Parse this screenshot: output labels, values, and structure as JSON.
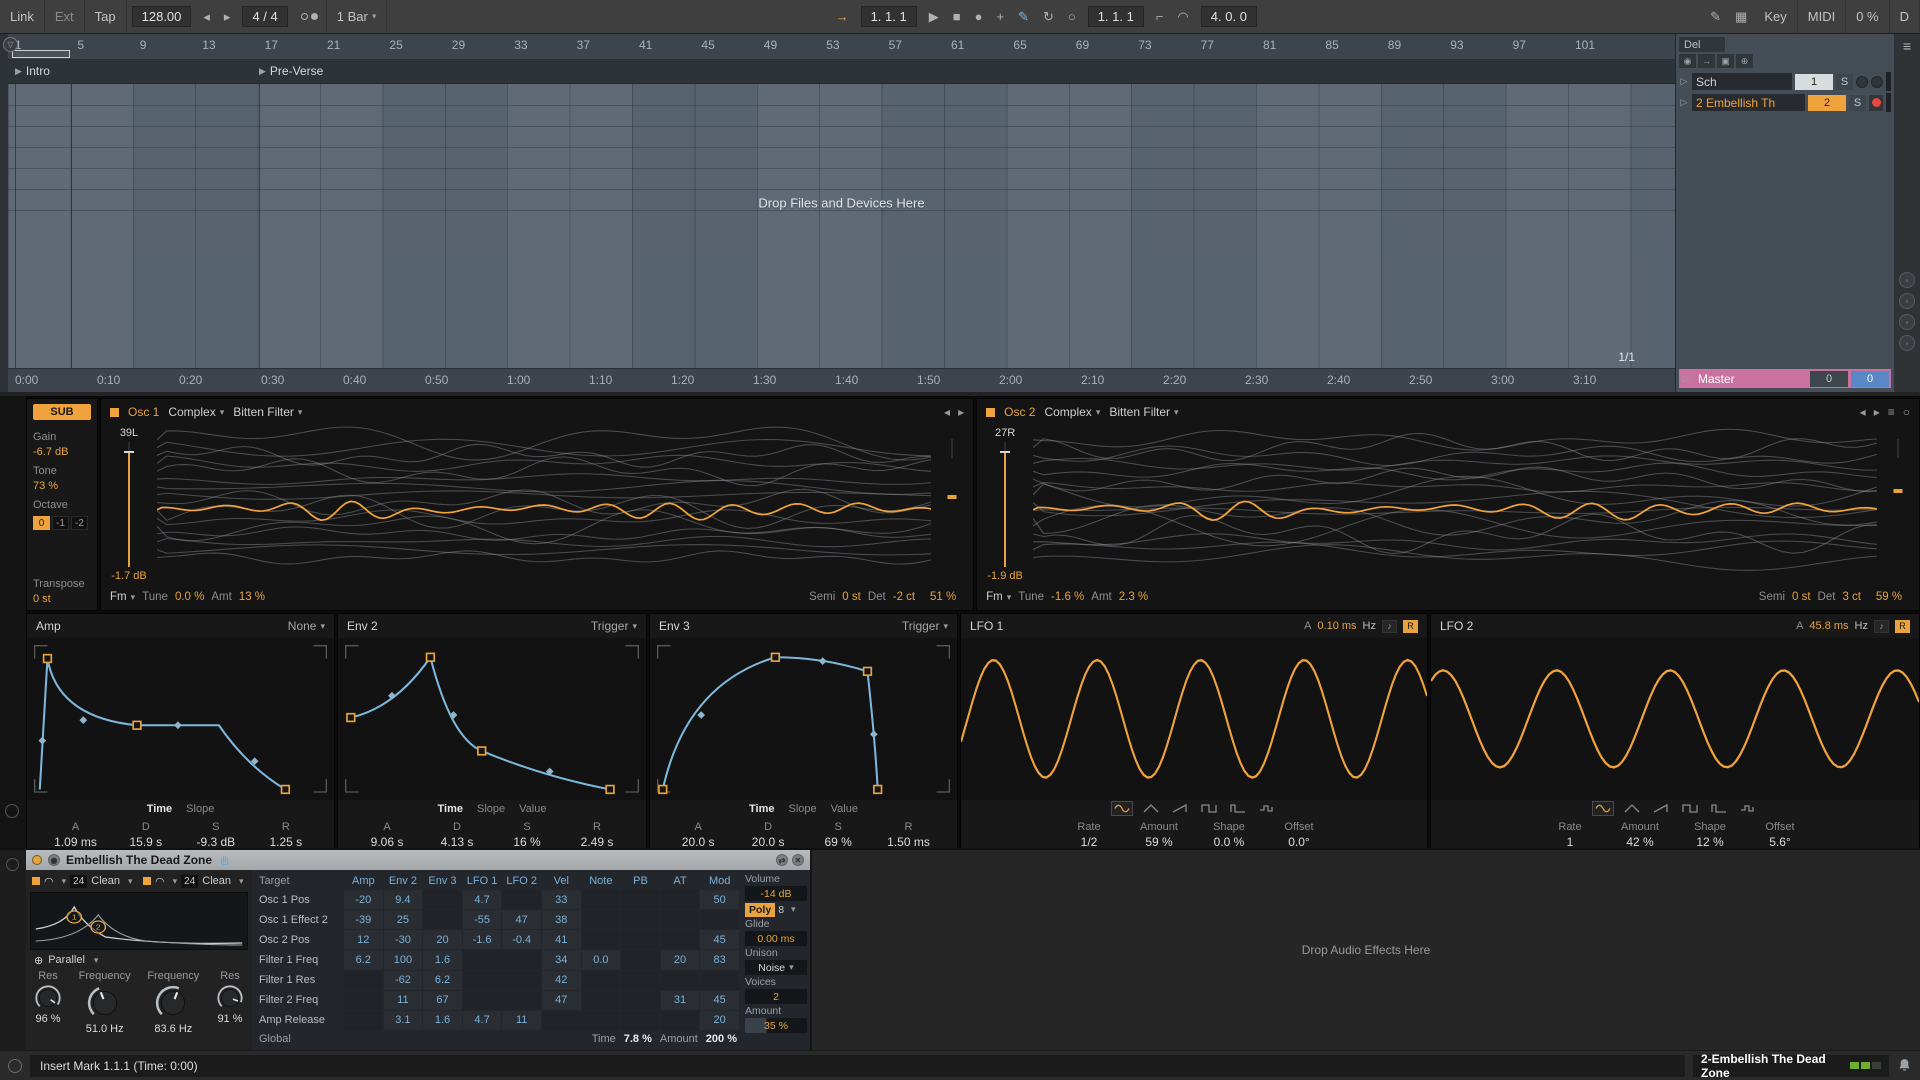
{
  "icons": {
    "caret": "▾",
    "menu": "≡",
    "follow": "→",
    "play": "▶",
    "stop": "■",
    "record": "●",
    "plus": "+",
    "draw": "✎",
    "reenable": "↻",
    "session_record": "○",
    "punch_in": "⌐",
    "slur": "◠",
    "pencil": "✎",
    "keyboard": "▦",
    "prev": "◂",
    "next": "▸",
    "fold": "▷",
    "note": "♪",
    "global_circle": "○",
    "routing": "⊕",
    "track_icons": [
      "◉",
      "→",
      "▣",
      "⊕"
    ]
  },
  "transport": {
    "link": "Link",
    "ext": "Ext",
    "tap": "Tap",
    "tempo": "128.00",
    "time_sig": "4 / 4",
    "quantize": "1 Bar",
    "pos": "1. 1. 1",
    "loop_start": "1. 1. 1",
    "loop_length": "4. 0. 0",
    "key": "Key",
    "midi": "MIDI",
    "cpu": "0 %",
    "disk": "D"
  },
  "arrangement": {
    "bars": [
      "1",
      "5",
      "9",
      "13",
      "17",
      "21",
      "25",
      "29",
      "33",
      "37",
      "41",
      "45",
      "49",
      "53",
      "57",
      "61",
      "65",
      "69",
      "73",
      "77",
      "81",
      "85",
      "89",
      "93",
      "97",
      "101"
    ],
    "times": [
      "0:00",
      "0:10",
      "0:20",
      "0:30",
      "0:40",
      "0:50",
      "1:00",
      "1:10",
      "1:20",
      "1:30",
      "1:40",
      "1:50",
      "2:00",
      "2:10",
      "2:20",
      "2:30",
      "2:40",
      "2:50",
      "3:00",
      "3:10"
    ],
    "locators": [
      {
        "name": "Intro"
      },
      {
        "name": "Pre-Verse"
      }
    ],
    "drop_hint": "Drop Files and Devices Here",
    "loop_ratio": "1/1",
    "del": "Del",
    "tracks": [
      {
        "name": "Sch",
        "num": "1",
        "solo": "S"
      },
      {
        "name": "2 Embellish Th",
        "num": "2",
        "solo": "S"
      }
    ],
    "master": {
      "name": "Master",
      "val1": "0",
      "val2": "0"
    }
  },
  "synth": {
    "sub": {
      "label": "SUB",
      "gain_label": "Gain",
      "gain": "-6.7 dB",
      "tone_label": "Tone",
      "tone": "73 %",
      "octave_label": "Octave",
      "oct0": "0",
      "oct1": "-1",
      "oct2": "-2",
      "transpose_label": "Transpose",
      "transpose": "0 st"
    },
    "osc1": {
      "title": "Osc 1",
      "category": "Complex",
      "table": "Bitten Filter",
      "pan": "39L",
      "gain": "-1.7 dB",
      "mode": "Fm",
      "tune_label": "Tune",
      "tune": "0.0 %",
      "amt_label": "Amt",
      "amt": "13 %",
      "semi_label": "Semi",
      "semi": "0 st",
      "det_label": "Det",
      "det": "-2 ct",
      "pos": "51 %"
    },
    "osc2": {
      "title": "Osc 2",
      "category": "Complex",
      "table": "Bitten Filter",
      "pan": "27R",
      "gain": "-1.9 dB",
      "mode": "Fm",
      "tune_label": "Tune",
      "tune": "-1.6 %",
      "amt_label": "Amt",
      "amt": "2.3 %",
      "semi_label": "Semi",
      "semi": "0 st",
      "det_label": "Det",
      "det": "3 ct",
      "pos": "59 %"
    },
    "amp": {
      "title": "Amp",
      "mode": "None",
      "tabs": [
        "Time",
        "Slope"
      ],
      "params": [
        [
          "A",
          "1.09 ms"
        ],
        [
          "D",
          "15.9 s"
        ],
        [
          "S",
          "-9.3 dB"
        ],
        [
          "R",
          "1.25 s"
        ]
      ]
    },
    "env2": {
      "title": "Env 2",
      "mode": "Trigger",
      "tabs": [
        "Time",
        "Slope",
        "Value"
      ],
      "params": [
        [
          "A",
          "9.06 s"
        ],
        [
          "D",
          "4.13 s"
        ],
        [
          "S",
          "16 %"
        ],
        [
          "R",
          "2.49 s"
        ]
      ]
    },
    "env3": {
      "title": "Env 3",
      "mode": "Trigger",
      "tabs": [
        "Time",
        "Slope",
        "Value"
      ],
      "params": [
        [
          "A",
          "20.0 s"
        ],
        [
          "D",
          "20.0 s"
        ],
        [
          "S",
          "69 %"
        ],
        [
          "R",
          "1.50 ms"
        ]
      ]
    },
    "lfo1": {
      "title": "LFO 1",
      "attack_label": "A",
      "attack": "0.10 ms",
      "hz": "Hz",
      "retrig": "R",
      "params": [
        [
          "Rate",
          "1/2"
        ],
        [
          "Amount",
          "59 %"
        ],
        [
          "Shape",
          "0.0 %"
        ],
        [
          "Offset",
          "0.0°"
        ]
      ]
    },
    "lfo2": {
      "title": "LFO 2",
      "attack_label": "A",
      "attack": "45.8 ms",
      "hz": "Hz",
      "retrig": "R",
      "params": [
        [
          "Rate",
          "1"
        ],
        [
          "Amount",
          "42 %"
        ],
        [
          "Shape",
          "12 %"
        ],
        [
          "Offset",
          "5.6°"
        ]
      ]
    }
  },
  "device": {
    "title": "Embellish The Dead Zone",
    "filters": {
      "f1_slope": "24",
      "f1_type": "Clean",
      "f2_slope": "24",
      "f2_type": "Clean",
      "f1_index": "1",
      "f2_index": "2",
      "routing": "Parallel",
      "res1_label": "Res",
      "res1": "96 %",
      "freq1_label": "Frequency",
      "freq1": "51.0 Hz",
      "freq2_label": "Frequency",
      "freq2": "83.6 Hz",
      "res2_label": "Res",
      "res2": "91 %"
    },
    "matrix": {
      "headers": [
        "Target",
        "Amp",
        "Env 2",
        "Env 3",
        "LFO 1",
        "LFO 2",
        "Vel",
        "Note",
        "PB",
        "AT",
        "Mod"
      ],
      "rows": [
        {
          "target": "Osc 1 Pos",
          "cells": [
            "-20",
            "9.4",
            "",
            "4.7",
            "",
            "33",
            "",
            "",
            "",
            "50"
          ]
        },
        {
          "target": "Osc 1 Effect 2",
          "cells": [
            "-39",
            "25",
            "",
            "-55",
            "47",
            "38",
            "",
            "",
            "",
            ""
          ]
        },
        {
          "target": "Osc 2 Pos",
          "cells": [
            "12",
            "-30",
            "20",
            "-1.6",
            "-0.4",
            "41",
            "",
            "",
            "",
            "45"
          ]
        },
        {
          "target": "Filter 1 Freq",
          "cells": [
            "6.2",
            "100",
            "1.6",
            "",
            "",
            "34",
            "0.0",
            "",
            "20",
            "83"
          ]
        },
        {
          "target": "Filter 1 Res",
          "cells": [
            "",
            "-62",
            "6.2",
            "",
            "",
            "42",
            "",
            "",
            "",
            ""
          ]
        },
        {
          "target": "Filter 2 Freq",
          "cells": [
            "",
            "11",
            "67",
            "",
            "",
            "47",
            "",
            "",
            "31",
            "45"
          ]
        },
        {
          "target": "Amp Release",
          "cells": [
            "",
            "3.1",
            "1.6",
            "4.7",
            "11",
            "",
            "",
            "",
            "",
            "20"
          ]
        }
      ],
      "global": "Global",
      "time_label": "Time",
      "time": "7.8 %",
      "amount_label": "Amount",
      "amount": "200 %"
    },
    "out": {
      "volume_label": "Volume",
      "volume": "-14 dB",
      "poly": "Poly",
      "poly_n": "8",
      "glide_label": "Glide",
      "glide": "0.00 ms",
      "unison_label": "Unison",
      "unison": "Noise",
      "voices_label": "Voices",
      "voices": "2",
      "amount_label": "Amount",
      "amount": "35 %"
    },
    "drop_hint": "Drop Audio Effects Here"
  },
  "status": {
    "left": "Insert Mark 1.1.1 (Time: 0:00)",
    "device_name": "2-Embellish The Dead Zone"
  }
}
